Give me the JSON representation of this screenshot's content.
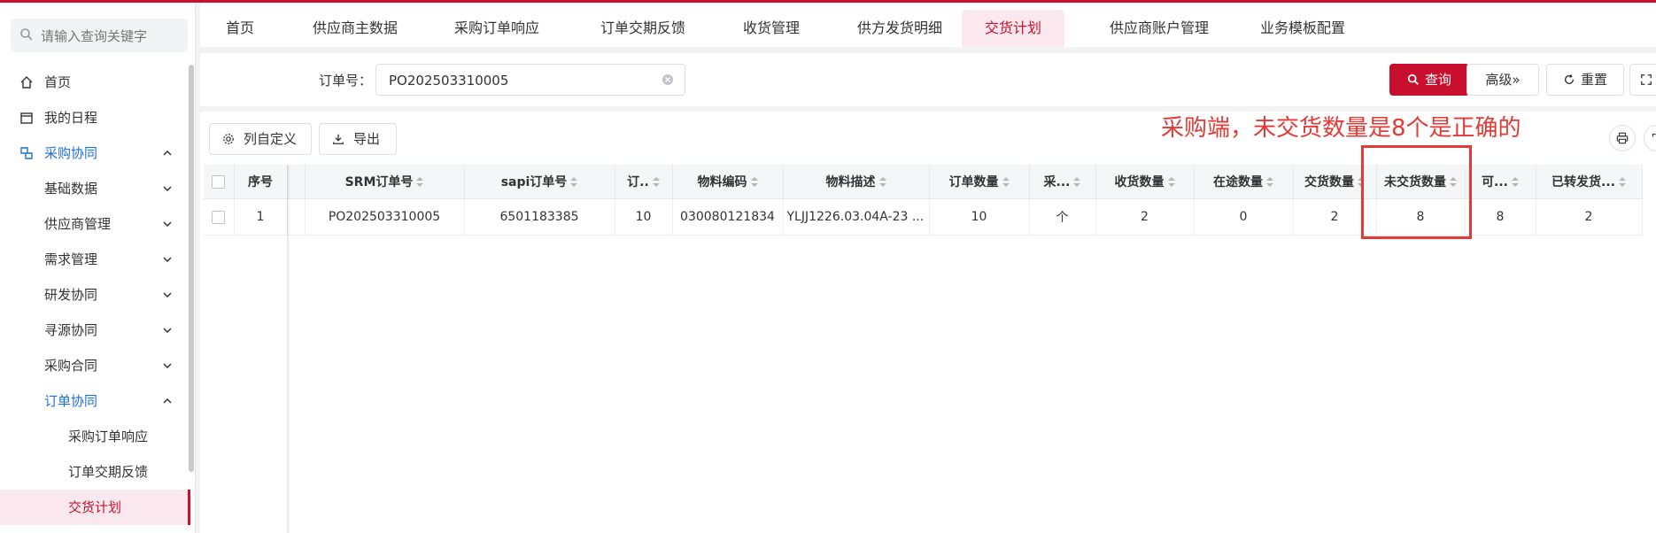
{
  "sidebar": {
    "search_placeholder": "请输入查询关键字",
    "items": [
      {
        "label": "首页"
      },
      {
        "label": "我的日程"
      },
      {
        "label": "采购协同"
      },
      {
        "label": "基础数据"
      },
      {
        "label": "供应商管理"
      },
      {
        "label": "需求管理"
      },
      {
        "label": "研发协同"
      },
      {
        "label": "寻源协同"
      },
      {
        "label": "采购合同"
      },
      {
        "label": "订单协同"
      },
      {
        "label": "采购订单响应"
      },
      {
        "label": "订单交期反馈"
      },
      {
        "label": "交货计划"
      }
    ]
  },
  "tabs": [
    "首页",
    "供应商主数据",
    "采购订单响应",
    "订单交期反馈",
    "收货管理",
    "供方发货明细",
    "交货计划",
    "供应商账户管理",
    "业务模板配置"
  ],
  "filter": {
    "order_label": "订单号：",
    "order_value": "PO202503310005",
    "query": "查询",
    "advanced": "高级»",
    "reset": "重置"
  },
  "toolbar": {
    "columns": "列自定义",
    "export": "导出"
  },
  "annotation": "采购端，未交货数量是8个是正确的",
  "table": {
    "headers": [
      "序号",
      "SRM订单号",
      "sapi订单号",
      "订..",
      "物料编码",
      "物料描述",
      "订单数量",
      "采...",
      "收货数量",
      "在途数量",
      "交货数量",
      "未交货数量",
      "可...",
      "已转发货..."
    ],
    "rows": [
      [
        "1",
        "PO202503310005",
        "6501183385",
        "10",
        "030080121834",
        "YLJJ1226.03.04A-23 ...",
        "10",
        "个",
        "2",
        "0",
        "2",
        "8",
        "8",
        "2"
      ]
    ]
  },
  "colors": {
    "brand": "#c8102e",
    "annotation": "#e53935",
    "active_nav": "#1e6fd9"
  }
}
